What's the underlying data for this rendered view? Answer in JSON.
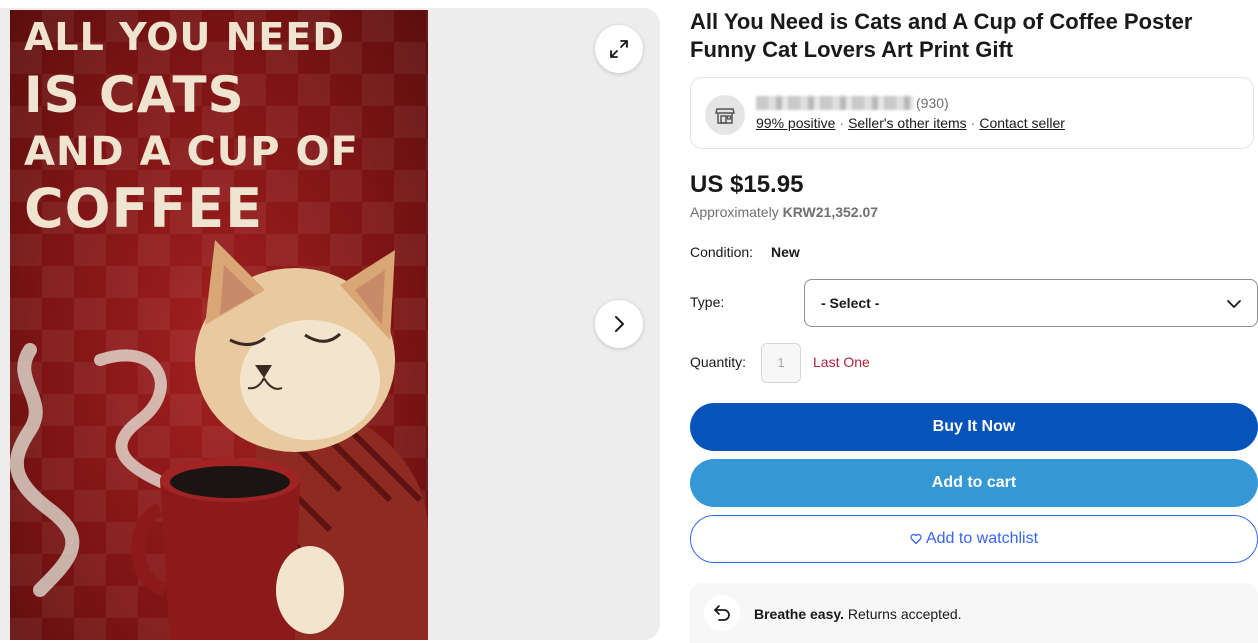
{
  "gallery": {
    "poster_lines": [
      "All You Need",
      "is Cats",
      "and A Cup of",
      "Coffee"
    ],
    "expand_icon": "expand-arrows-icon",
    "next_icon": "chevron-right-icon"
  },
  "product": {
    "title": "All You Need is Cats and A Cup of Coffee Poster Funny Cat Lovers Art Print Gift"
  },
  "seller": {
    "icon": "store-icon",
    "feedback_count": "(930)",
    "positive_label": "99% positive",
    "other_items_label": "Seller's other items",
    "contact_label": "Contact seller",
    "separator": "·"
  },
  "pricing": {
    "price": "US $15.95",
    "approx_prefix": "Approximately",
    "approx_value": "KRW21,352.07"
  },
  "condition": {
    "label": "Condition:",
    "value": "New"
  },
  "type": {
    "label": "Type:",
    "selected": "- Select -"
  },
  "quantity": {
    "label": "Quantity:",
    "value": "1",
    "note": "Last One"
  },
  "buttons": {
    "buy_now": "Buy It Now",
    "add_to_cart": "Add to cart",
    "watchlist": "Add to watchlist"
  },
  "returns": {
    "icon": "return-arrow-icon",
    "bold": "Breathe easy.",
    "text": " Returns accepted."
  },
  "colors": {
    "buy_now": "#0654ba",
    "add_to_cart": "#3597d3",
    "watchlist_text": "#3665f3",
    "last_one": "#b0223a",
    "poster_red": "#7d1414"
  }
}
